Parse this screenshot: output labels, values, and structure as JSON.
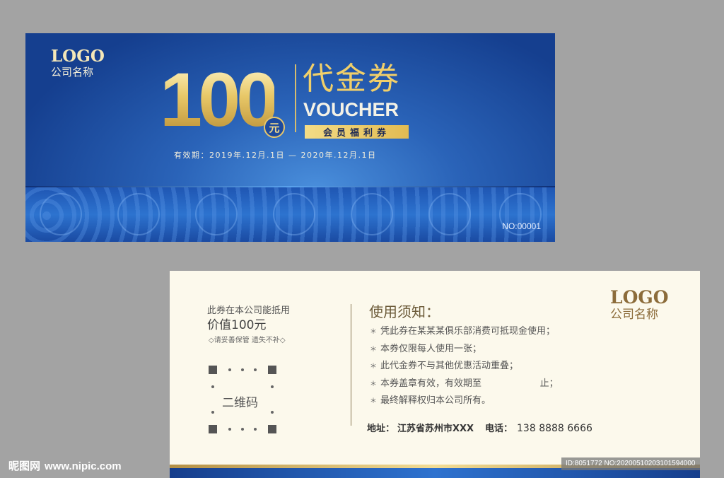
{
  "front": {
    "logo": "LOGO",
    "company": "公司名称",
    "amount": "100",
    "yuan": "元",
    "title_cn": "代金券",
    "title_en": "VOUCHER",
    "member_tag": "会员福利券",
    "validity": "有效期：2019年.12月.1日 — 2020年.12月.1日",
    "serial": "NO:00001",
    "colors": {
      "primary": "#1f56b3",
      "gold": "#e6c66c"
    }
  },
  "back": {
    "offset_text": "此券在本公司能抵用",
    "value_text": "价值100元",
    "care_text": "◇请妥善保管 遗失不补◇",
    "qr_label": "二维码",
    "notice_title": "使用须知：",
    "notice_star": "＊",
    "notices": [
      "凭此券在某某某俱乐部消费可抵现金使用；",
      "本券仅限每人使用一张；",
      "此代金券不与其他优惠活动重叠；",
      "本券盖章有效，有效期至                    止；",
      "最终解释权归本公司所有。"
    ],
    "address_label": "地址：",
    "address_value": "江苏省苏州市XXX",
    "phone_label": "电话：",
    "phone_value": "138 8888 6666",
    "logo": "LOGO",
    "company": "公司名称"
  },
  "watermark": {
    "brand": "昵图网",
    "site": "www.nipic.com",
    "id_text": "ID:8051772 NO:20200510203101594000"
  }
}
